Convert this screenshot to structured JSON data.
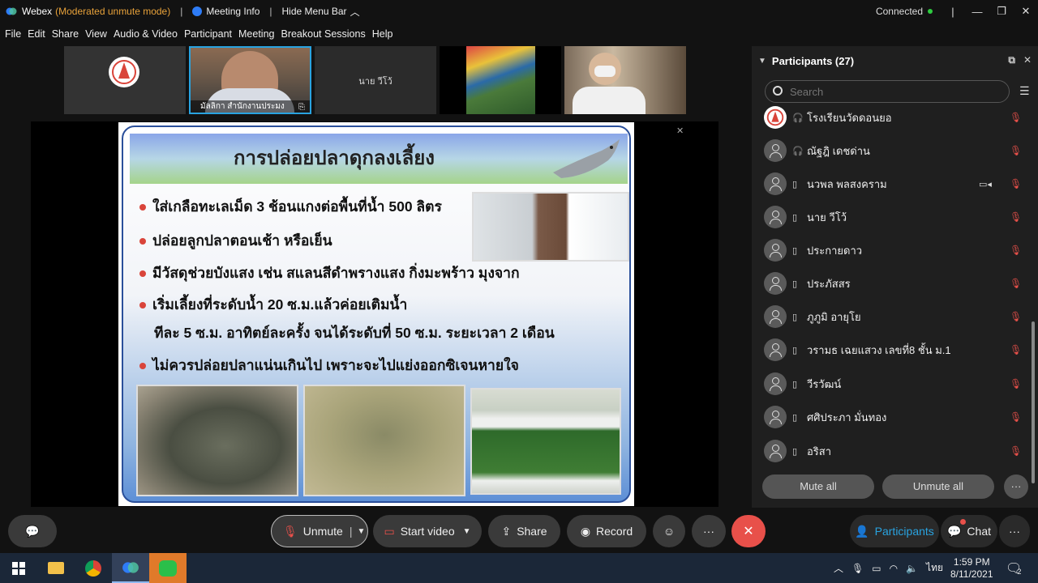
{
  "titlebar": {
    "app": "Webex",
    "mode": "(Moderated unmute mode)",
    "meeting_info": "Meeting Info",
    "hide_menu": "Hide Menu Bar",
    "connection": "Connected"
  },
  "menu": [
    "File",
    "Edit",
    "Share",
    "View",
    "Audio & Video",
    "Participant",
    "Meeting",
    "Breakout Sessions",
    "Help"
  ],
  "videos": [
    {
      "name": ""
    },
    {
      "name": "มัลลิกา สำนักงานประมง"
    },
    {
      "name": "นาย วีโว้"
    },
    {
      "name": ""
    },
    {
      "name": ""
    }
  ],
  "slide": {
    "title": "การปล่อยปลาดุกลงเลี้ยง",
    "bullets": [
      "ใส่เกลือทะเลเม็ด 3 ช้อนแกงต่อพื้นที่น้ำ 500 ลิตร",
      "ปล่อยลูกปลาตอนเช้า หรือเย็น",
      "มีวัสดุช่วยบังแสง เช่น สแลนสีดำพรางแสง กิ่งมะพร้าว มุงจาก",
      "เริ่มเลี้ยงที่ระดับน้ำ 20 ซ.ม.แล้วค่อยเติมน้ำ",
      "ทีละ 5 ซ.ม. อาทิตย์ละครั้ง จนได้ระดับที่ 50 ซ.ม. ระยะเวลา 2 เดือน",
      "ไม่ควรปล่อยปลาแน่นเกินไป เพราะจะไปแย่งออกซิเจนหายใจ"
    ]
  },
  "participants": {
    "title": "Participants (27)",
    "search_placeholder": "Search",
    "list": [
      {
        "name": "โรงเรียนวัดดอนยอ",
        "logo": true,
        "device": "headset",
        "camera": false
      },
      {
        "name": "ณัฐฎิ เดชด่าน",
        "logo": false,
        "device": "headset",
        "camera": false
      },
      {
        "name": "นวพล พลสงคราม",
        "logo": false,
        "device": "mobile",
        "camera": true
      },
      {
        "name": "นาย วีโว้",
        "logo": false,
        "device": "mobile",
        "camera": false
      },
      {
        "name": "ประกายดาว",
        "logo": false,
        "device": "mobile",
        "camera": false
      },
      {
        "name": "ประภัสสร",
        "logo": false,
        "device": "mobile",
        "camera": false
      },
      {
        "name": "ภูภูมิ อายุโย",
        "logo": false,
        "device": "mobile",
        "camera": false
      },
      {
        "name": "วรามธ เฉยแสวง เลขที่8 ชั้น ม.1",
        "logo": false,
        "device": "mobile",
        "camera": false
      },
      {
        "name": "วีรวัฒน์",
        "logo": false,
        "device": "mobile",
        "camera": false
      },
      {
        "name": "ศศิประภา มั่นทอง",
        "logo": false,
        "device": "mobile",
        "camera": false
      },
      {
        "name": "อริสา",
        "logo": false,
        "device": "mobile",
        "camera": false
      }
    ],
    "mute_all": "Mute all",
    "unmute_all": "Unmute all"
  },
  "controls": {
    "unmute": "Unmute",
    "start_video": "Start video",
    "share": "Share",
    "record": "Record",
    "participants": "Participants",
    "chat": "Chat"
  },
  "taskbar": {
    "lang": "ไทย",
    "time": "1:59 PM",
    "date": "8/11/2021",
    "notifications": "2"
  },
  "colors": {
    "accent": "#29a3e0",
    "muted": "#e8504a",
    "warning": "#e8a23a",
    "online": "#2ecc40"
  }
}
